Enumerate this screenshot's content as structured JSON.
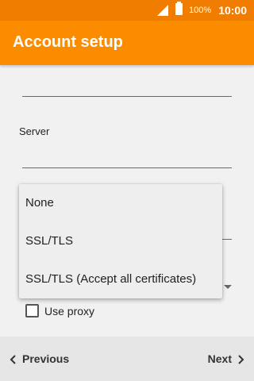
{
  "status_bar": {
    "battery_percent": "100%",
    "time": "10:00",
    "icons": [
      "signal-icon",
      "battery-icon"
    ]
  },
  "app_bar": {
    "title": "Account setup",
    "color": "#fb8c00"
  },
  "form": {
    "server_label": "Server",
    "server_value": "",
    "use_proxy_label": "Use proxy",
    "use_proxy_checked": false
  },
  "security_dropdown": {
    "options": [
      "None",
      "SSL/TLS",
      "SSL/TLS (Accept all certificates)"
    ]
  },
  "footer": {
    "previous_label": "Previous",
    "next_label": "Next"
  }
}
